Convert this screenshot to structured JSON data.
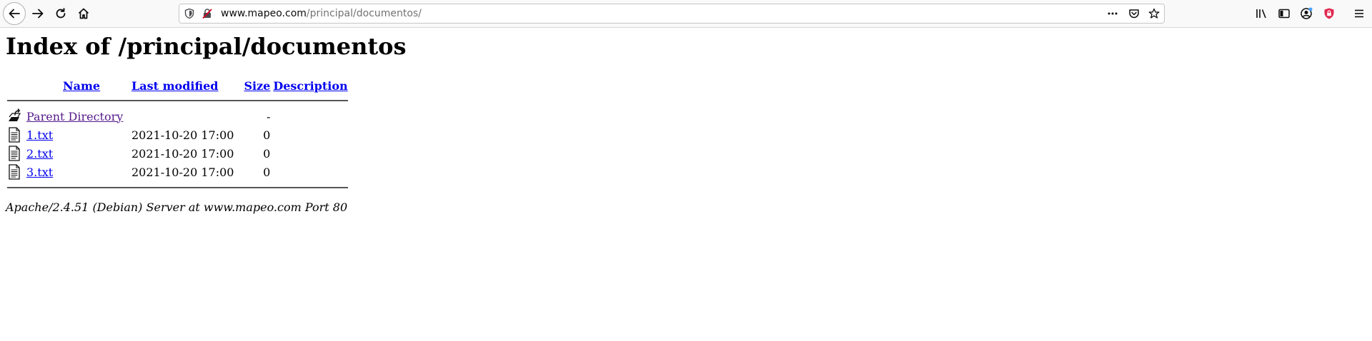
{
  "browser": {
    "url_host": "www.mapeo.com",
    "url_path": "/principal/documentos/",
    "icons": {
      "back": "back-arrow-icon",
      "forward": "forward-arrow-icon",
      "reload": "reload-icon",
      "home": "home-icon",
      "site_info": "shield-icon",
      "insecure": "insecure-lock-icon",
      "page_actions": "more-dots-icon",
      "pocket": "pocket-icon",
      "bookmark": "star-icon",
      "library": "library-icon",
      "sidebar": "sidebar-icon",
      "account": "account-icon",
      "extension": "extension-shield-icon",
      "menu": "hamburger-menu-icon"
    }
  },
  "page": {
    "title": "Index of /principal/documentos",
    "columns": {
      "name": "Name",
      "last_modified": "Last modified",
      "size": "Size",
      "description": "Description"
    },
    "parent": {
      "name": "Parent Directory",
      "size": "-"
    },
    "files": [
      {
        "name": "1.txt",
        "modified": "2021-10-20 17:00",
        "size": "0",
        "description": ""
      },
      {
        "name": "2.txt",
        "modified": "2021-10-20 17:00",
        "size": "0",
        "description": ""
      },
      {
        "name": "3.txt",
        "modified": "2021-10-20 17:00",
        "size": "0",
        "description": ""
      }
    ],
    "footer": "Apache/2.4.51 (Debian) Server at www.mapeo.com Port 80"
  },
  "colors": {
    "link": "#0000ee",
    "visited_link": "#551a8b",
    "extension_red": "#e22850",
    "notification_dot": "#45a1ff"
  }
}
